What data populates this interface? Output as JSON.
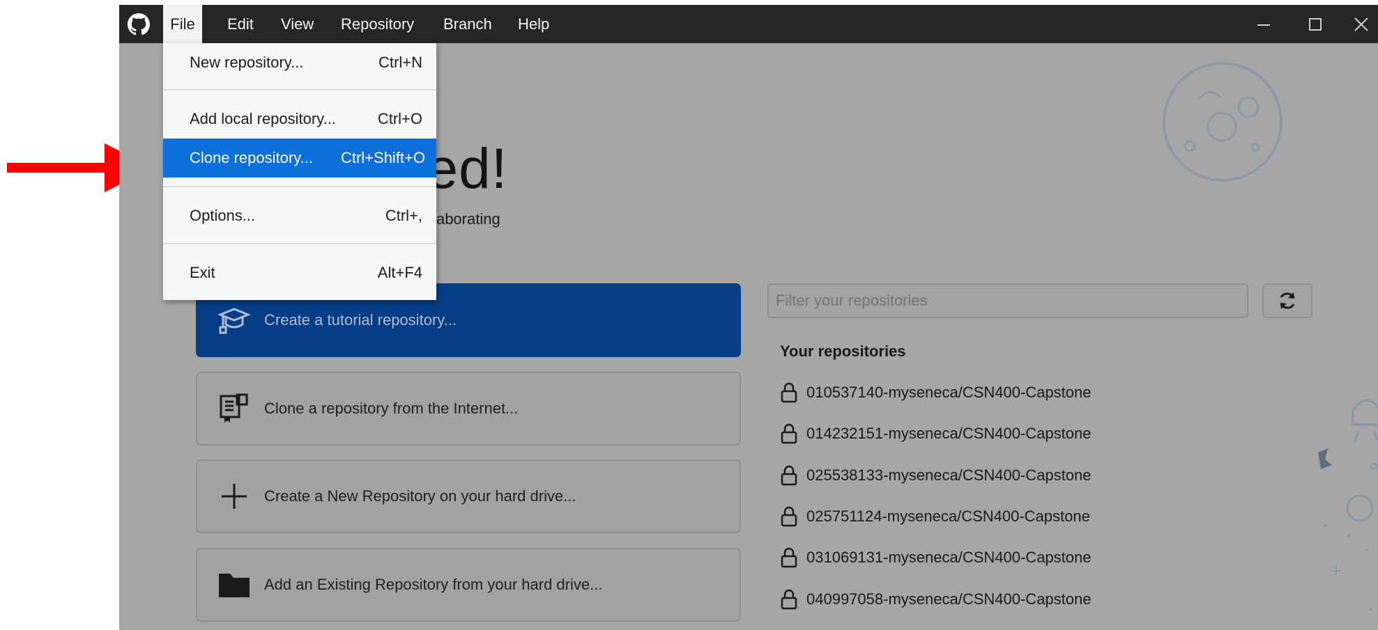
{
  "menubar": {
    "items": [
      "File",
      "Edit",
      "View",
      "Repository",
      "Branch",
      "Help"
    ],
    "active": "File"
  },
  "file_menu": {
    "items": [
      {
        "label": "New repository...",
        "shortcut": "Ctrl+N"
      },
      {
        "label": "Add local repository...",
        "shortcut": "Ctrl+O"
      },
      {
        "label": "Clone repository...",
        "shortcut": "Ctrl+Shift+O"
      },
      {
        "label": "Options...",
        "shortcut": "Ctrl+,"
      },
      {
        "label": "Exit",
        "shortcut": "Alt+F4"
      }
    ],
    "highlighted": "Clone repository..."
  },
  "welcome": {
    "heading_visible": "tarted!",
    "subheading_visible": "op to start collaborating"
  },
  "actions": [
    {
      "label": "Create a tutorial repository...",
      "icon": "graduation-cap-icon"
    },
    {
      "label": "Clone a repository from the Internet...",
      "icon": "book-clone-icon"
    },
    {
      "label": "Create a New Repository on your hard drive...",
      "icon": "plus-icon"
    },
    {
      "label": "Add an Existing Repository from your hard drive...",
      "icon": "folder-icon"
    }
  ],
  "repos": {
    "filter_placeholder": "Filter your repositories",
    "section_title": "Your repositories",
    "items": [
      "010537140-myseneca/CSN400-Capstone",
      "014232151-myseneca/CSN400-Capstone",
      "025538133-myseneca/CSN400-Capstone",
      "025751124-myseneca/CSN400-Capstone",
      "031069131-myseneca/CSN400-Capstone",
      "040997058-myseneca/CSN400-Capstone"
    ]
  },
  "colors": {
    "titlebar": "#262626",
    "overlay_bg": "#a6a6a6",
    "primary_button": "#053e85",
    "menu_highlight": "#0d6fd9",
    "annotation_arrow": "#ff0000"
  }
}
